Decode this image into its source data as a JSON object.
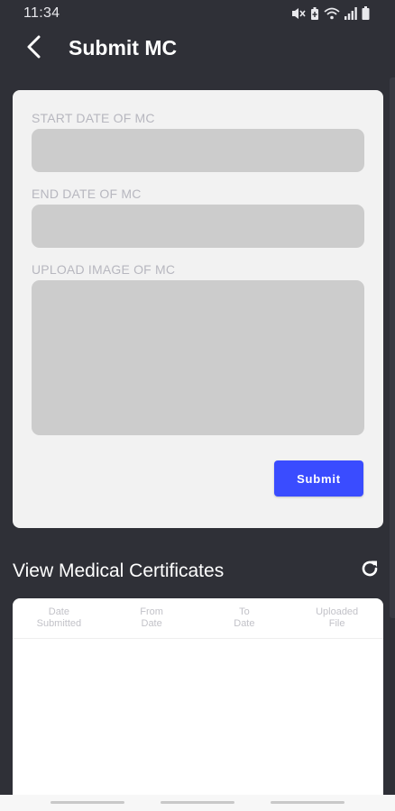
{
  "status_bar": {
    "time": "11:34",
    "icons": [
      "mute-icon",
      "battery-saver-icon",
      "wifi-icon",
      "signal-icon",
      "battery-icon"
    ]
  },
  "app_bar": {
    "title": "Submit MC",
    "back_icon": "chevron-left-icon"
  },
  "form": {
    "start_date_label": "START DATE OF MC",
    "start_date_value": "",
    "end_date_label": "END DATE OF MC",
    "end_date_value": "",
    "upload_label": "UPLOAD IMAGE OF MC",
    "submit_label": "Submit"
  },
  "colors": {
    "background": "#2f3037",
    "card": "#f2f2f2",
    "field": "#cccccc",
    "accent": "#3a4cff",
    "label": "#b7b7bf"
  },
  "list_section": {
    "title": "View Medical Certificates",
    "refresh_icon": "refresh-icon",
    "columns": [
      "Date\nSubmitted",
      "From\nDate",
      "To\nDate",
      "Uploaded\nFile"
    ],
    "rows": []
  }
}
